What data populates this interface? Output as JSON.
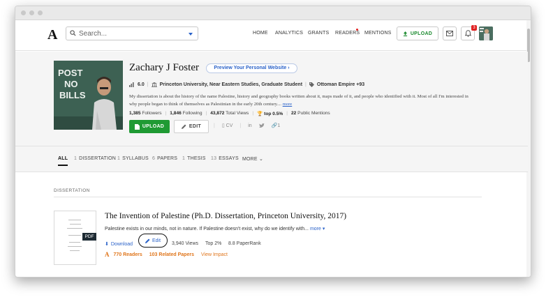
{
  "nav": {
    "logo": "A",
    "search_placeholder": "Search...",
    "links": [
      "HOME",
      "ANALYTICS",
      "GRANTS",
      "READERS",
      "MENTIONS"
    ],
    "upload_label": "UPLOAD",
    "notifications_count": "3"
  },
  "profile": {
    "name": "Zachary J Foster",
    "preview_label": "Preview Your Personal Website",
    "score": "6.0",
    "affiliation": "Princeton University, Near Eastern Studies, Graduate Student",
    "interests": "Ottoman Empire +93",
    "bio": "My dissertation is about the history of the name Palestine, history and geography books written about it, maps made of it, and people who identified with it.  Most of all I'm interested in why people began to think of themselves as Palestinian in the early 20th century....",
    "bio_more": "more",
    "followers_num": "1,385",
    "followers_label": "Followers",
    "following_num": "1,846",
    "following_label": "Following",
    "views_num": "43,872",
    "views_label": "Total Views",
    "top_label": "top 0.5%",
    "mentions_num": "22",
    "mentions_label": "Public Mentions",
    "upload_label": "UPLOAD",
    "edit_label": "EDIT",
    "cv_label": "CV",
    "linkedin_label": "in",
    "share_count": "1",
    "photo_text": [
      "POST",
      "NO",
      "BILLS"
    ]
  },
  "tabs": [
    {
      "count": "",
      "label": "ALL"
    },
    {
      "count": "1",
      "label": "DISSERTATION"
    },
    {
      "count": "1",
      "label": "SYLLABUS"
    },
    {
      "count": "6",
      "label": "PAPERS"
    },
    {
      "count": "1",
      "label": "THESIS"
    },
    {
      "count": "13",
      "label": "ESSAYS"
    },
    {
      "count": "",
      "label": "MORE"
    }
  ],
  "section": {
    "label": "DISSERTATION"
  },
  "document": {
    "pdf_tag": "PDF",
    "title": "The Invention of Palestine (Ph.D. Dissertation, Princeton University, 2017)",
    "description": "Palestine exists in our minds, not in nature. If Palestine doesn't exist, why do we identify with...",
    "more": "more",
    "download_label": "Download",
    "edit_label": "Edit",
    "views": "3,940 Views",
    "top": "Top 2%",
    "paperrank": "8.8 PaperRank",
    "readers": "770 Readers",
    "related": "103 Related Papers",
    "impact": "View Impact"
  }
}
